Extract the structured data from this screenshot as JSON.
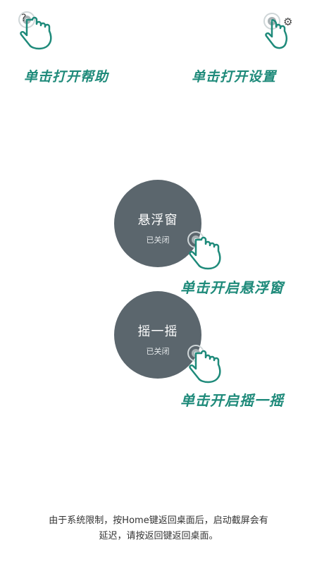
{
  "top": {
    "help_hint": "单击打开帮助",
    "settings_hint": "单击打开设置"
  },
  "toggles": [
    {
      "title": "悬浮窗",
      "status": "已关闭",
      "hint": "单击开启悬浮窗"
    },
    {
      "title": "摇一摇",
      "status": "已关闭",
      "hint": "单击开启摇一摇"
    }
  ],
  "footer": {
    "line1": "由于系统限制，按Home键返回桌面后，启动截屏会有",
    "line2": "延迟，请按返回键返回桌面。"
  },
  "colors": {
    "accent": "#1e8a7a",
    "circle": "#5b666d",
    "background": "#ffffff"
  },
  "icons": {
    "help": "help-icon",
    "settings": "settings-icon",
    "tap_hand": "tap-hand-icon"
  }
}
